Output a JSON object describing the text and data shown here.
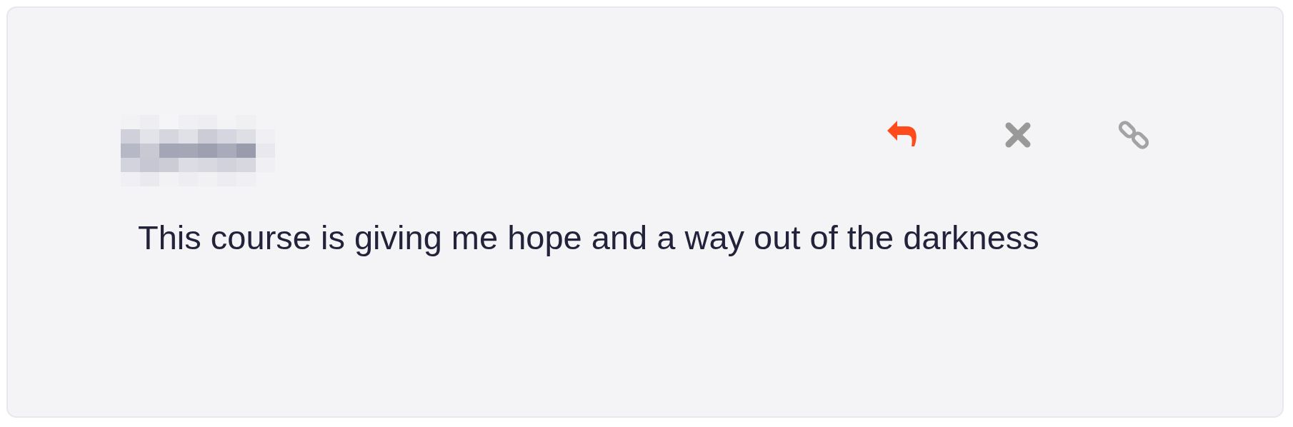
{
  "comment": {
    "text": "This course is giving me hope and a way out of the darkness"
  }
}
